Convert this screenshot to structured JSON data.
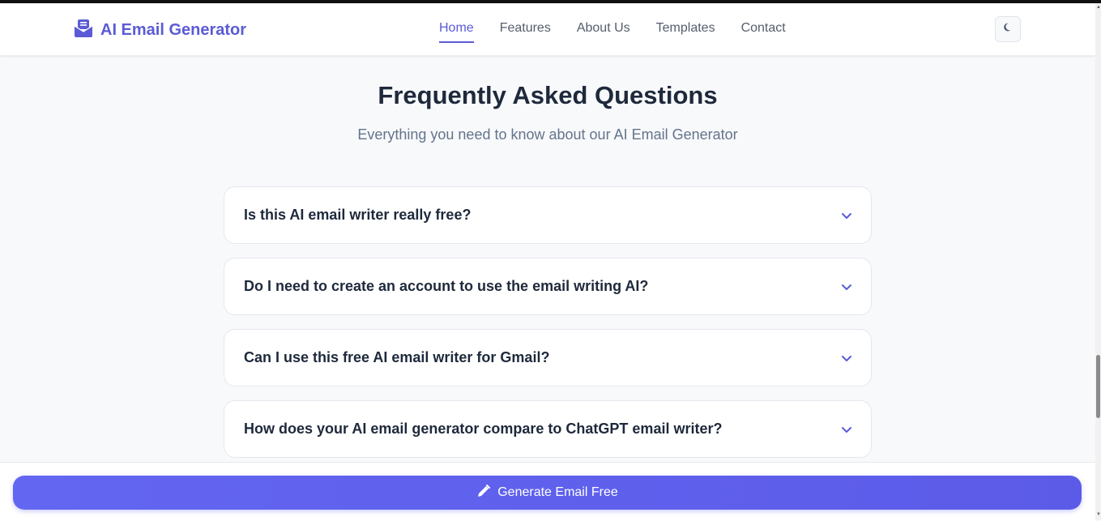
{
  "header": {
    "logo_icon": "envelope-letter-icon",
    "logo_text": "AI Email Generator",
    "nav": [
      {
        "label": "Home",
        "active": true
      },
      {
        "label": "Features",
        "active": false
      },
      {
        "label": "About Us",
        "active": false
      },
      {
        "label": "Templates",
        "active": false
      },
      {
        "label": "Contact",
        "active": false
      }
    ],
    "theme_toggle_icon": "moon-icon"
  },
  "faq": {
    "title": "Frequently Asked Questions",
    "subtitle": "Everything you need to know about our AI Email Generator",
    "items": [
      {
        "question": "Is this AI email writer really free?"
      },
      {
        "question": "Do I need to create an account to use the email writing AI?"
      },
      {
        "question": "Can I use this free AI email writer for Gmail?"
      },
      {
        "question": "How does your AI email generator compare to ChatGPT email writer?"
      }
    ]
  },
  "cta": {
    "icon": "pencil-icon",
    "label": "Generate Email Free"
  },
  "colors": {
    "accent": "#5b5bd6",
    "button": "#6366f1",
    "background": "#f8f9fb"
  }
}
